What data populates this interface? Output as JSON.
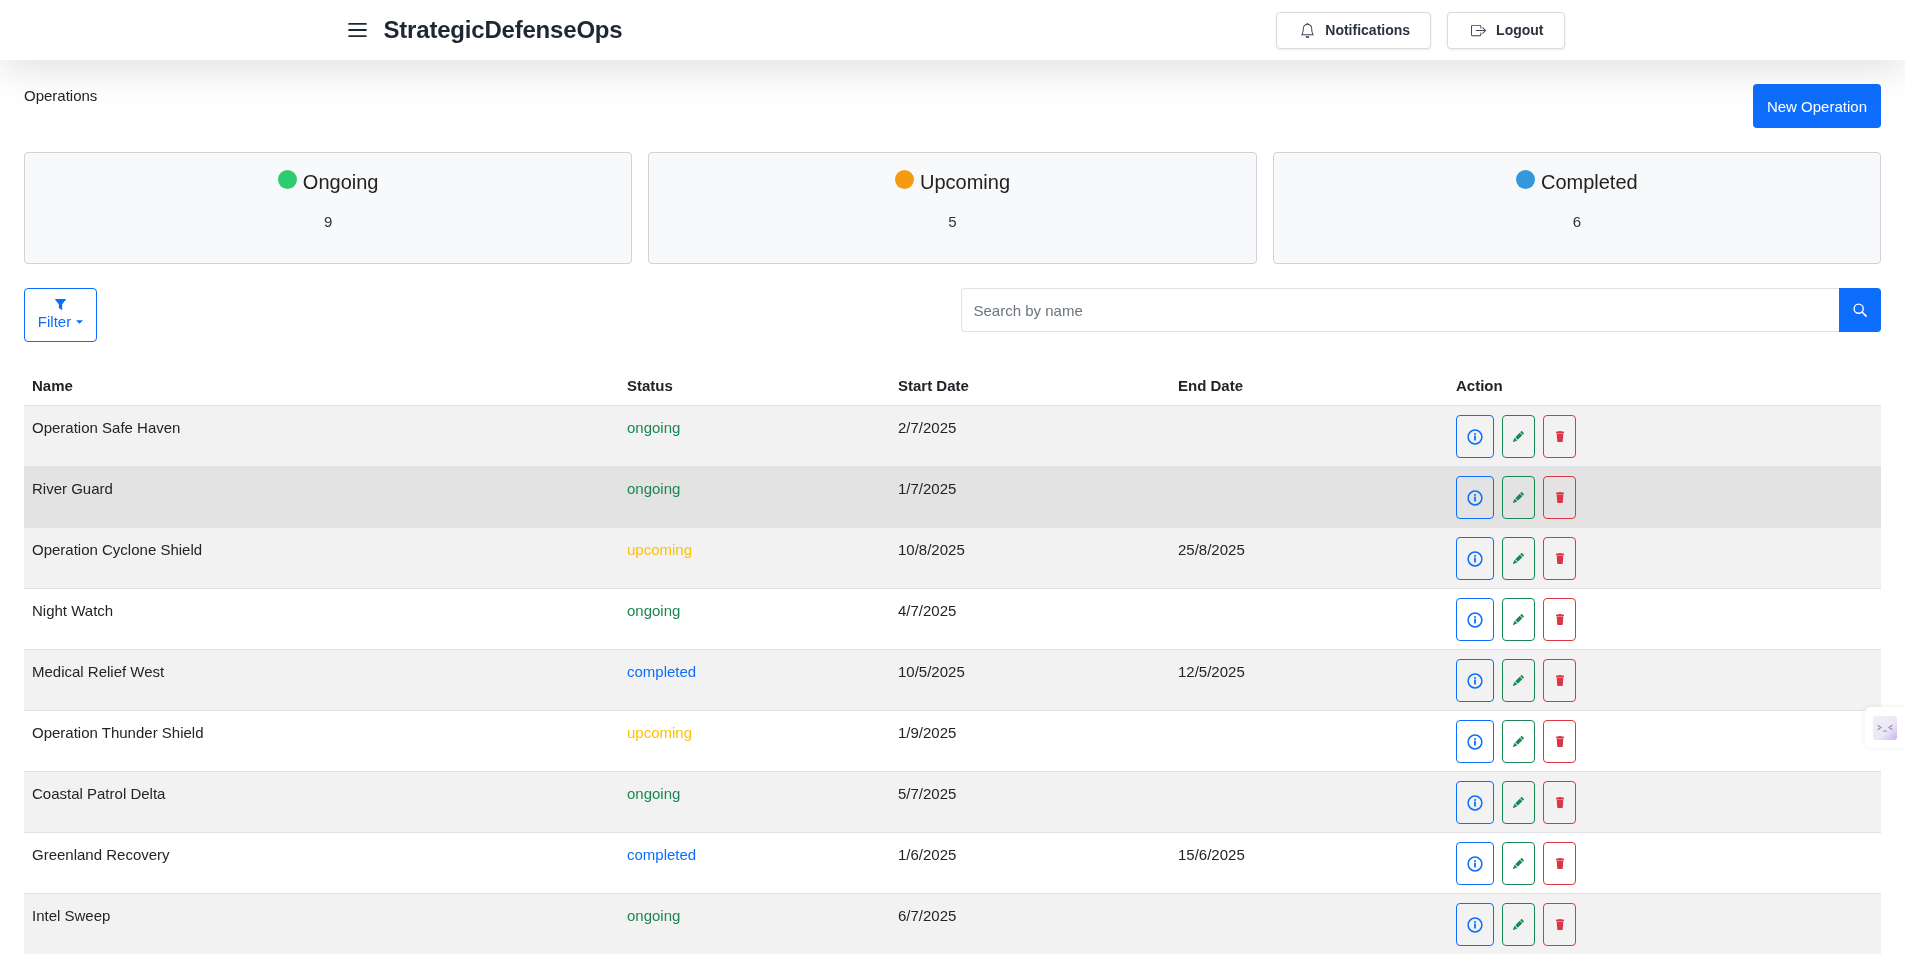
{
  "header": {
    "title": "StrategicDefenseOps",
    "buttons": [
      {
        "label": "Notifications",
        "kind": "bell"
      },
      {
        "label": "Logout",
        "kind": "logout"
      }
    ]
  },
  "page": {
    "title": "Operations",
    "new_button": "New Operation"
  },
  "stats": [
    {
      "label": "Ongoing",
      "count": "9",
      "color": "#2ecc71"
    },
    {
      "label": "Upcoming",
      "count": "5",
      "color": "#f39c12"
    },
    {
      "label": "Completed",
      "count": "6",
      "color": "#3498db"
    }
  ],
  "filter": {
    "label": "Filter"
  },
  "search": {
    "placeholder": "Search by name"
  },
  "table": {
    "columns": [
      "Name",
      "Status",
      "Start Date",
      "End Date",
      "Action"
    ],
    "rows": [
      {
        "name": "Operation Safe Haven",
        "status": {
          "text": "ongoing",
          "color": "#198754"
        },
        "start": "2/7/2025",
        "hovered": false
      },
      {
        "name": "River Guard",
        "status": {
          "text": "ongoing",
          "color": "#198754"
        },
        "start": "1/7/2025",
        "hovered": true
      },
      {
        "name": "Operation Cyclone Shield",
        "status": {
          "text": "upcoming",
          "color": "#ffc107"
        },
        "start": "10/8/2025",
        "end": "25/8/2025",
        "hovered": false
      },
      {
        "name": "Night Watch",
        "status": {
          "text": "ongoing",
          "color": "#198754"
        },
        "start": "4/7/2025",
        "hovered": false
      },
      {
        "name": "Medical Relief West",
        "status": {
          "text": "completed",
          "color": "#0d6efd"
        },
        "start": "10/5/2025",
        "end": "12/5/2025",
        "hovered": false
      },
      {
        "name": "Operation Thunder Shield",
        "status": {
          "text": "upcoming",
          "color": "#ffc107"
        },
        "start": "1/9/2025",
        "hovered": false
      },
      {
        "name": "Coastal Patrol Delta",
        "status": {
          "text": "ongoing",
          "color": "#198754"
        },
        "start": "5/7/2025",
        "hovered": false
      },
      {
        "name": "Greenland Recovery",
        "status": {
          "text": "completed",
          "color": "#0d6efd"
        },
        "start": "1/6/2025",
        "end": "15/6/2025",
        "hovered": false
      },
      {
        "name": "Intel Sweep",
        "status": {
          "text": "ongoing",
          "color": "#198754"
        },
        "start": "6/7/2025",
        "hovered": false
      }
    ]
  }
}
